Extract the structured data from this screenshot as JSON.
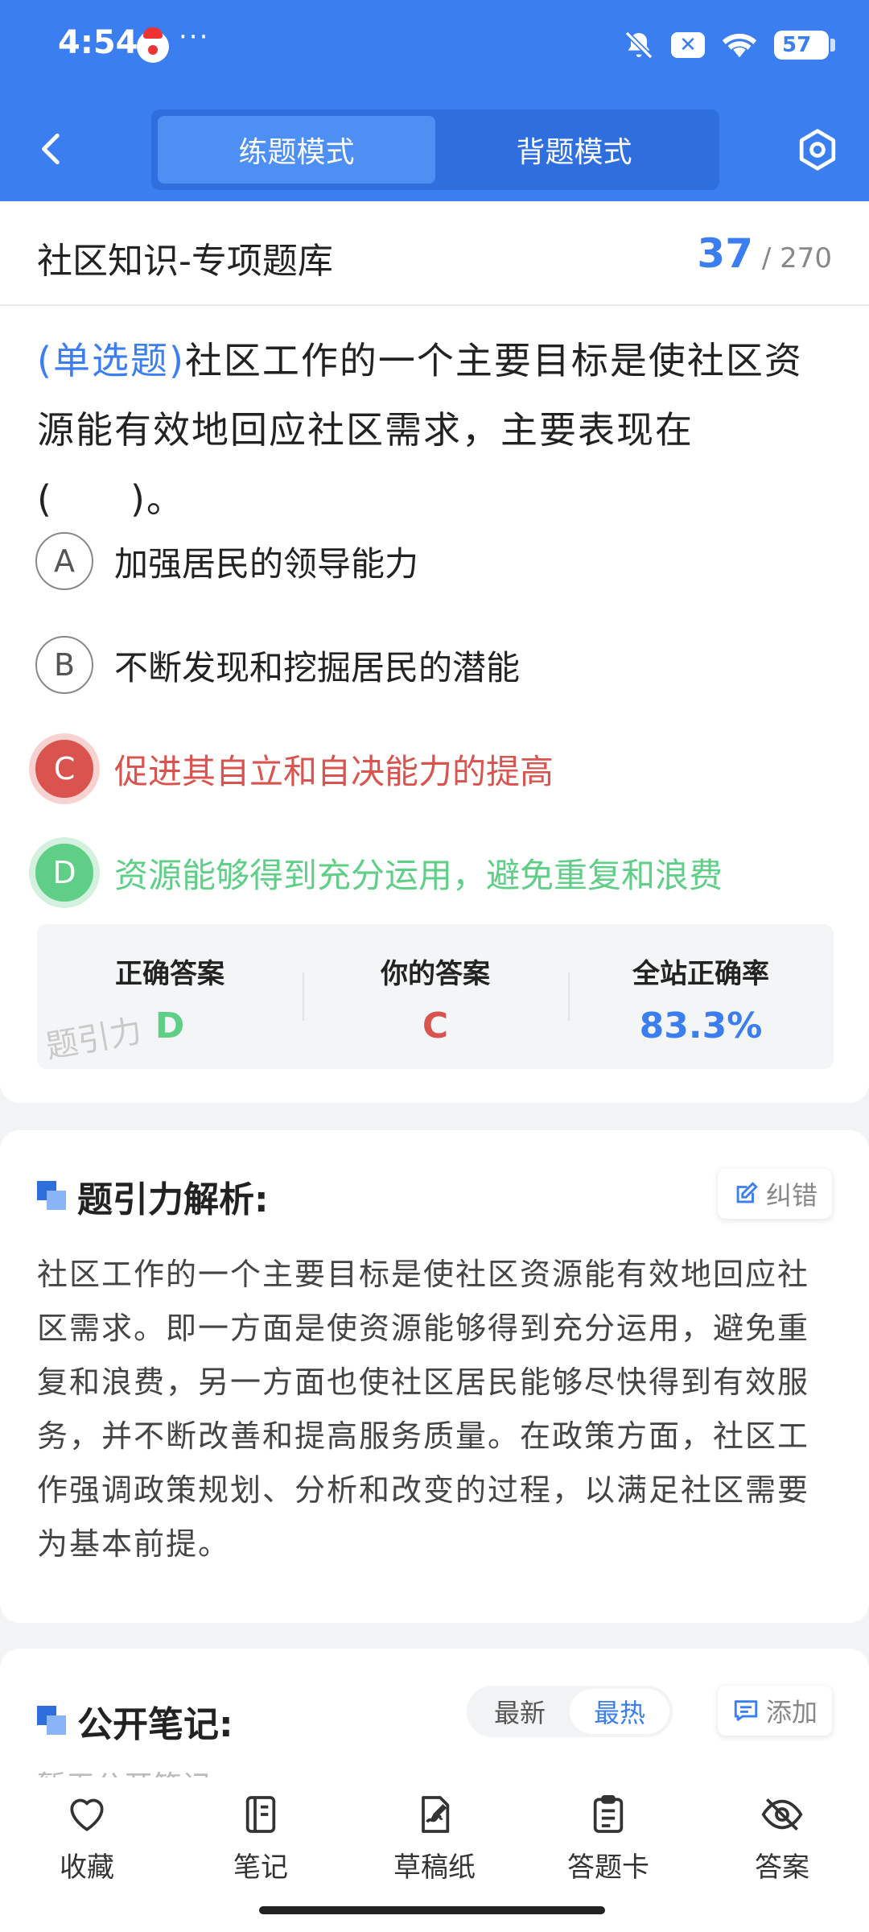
{
  "status_bar": {
    "time": "4:54",
    "dots": "···",
    "battery": "57"
  },
  "header": {
    "modes": [
      "练题模式",
      "背题模式"
    ],
    "active_mode": 0
  },
  "bank": {
    "title": "社区知识-专项题库",
    "current": "37",
    "total": "/ 270"
  },
  "question": {
    "type_label": "(单选题)",
    "text": "社区工作的一个主要目标是使社区资源能有效地回应社区需求，主要表现在(　　)。"
  },
  "options": [
    {
      "letter": "A",
      "text": "加强居民的领导能力",
      "state": "normal"
    },
    {
      "letter": "B",
      "text": "不断发现和挖掘居民的潜能",
      "state": "normal"
    },
    {
      "letter": "C",
      "text": "促进其自立和自决能力的提高",
      "state": "wrong"
    },
    {
      "letter": "D",
      "text": "资源能够得到充分运用，避免重复和浪费",
      "state": "right"
    }
  ],
  "result": {
    "correct_label": "正确答案",
    "correct_value": "D",
    "yours_label": "你的答案",
    "yours_value": "C",
    "rate_label": "全站正确率",
    "rate_value": "83.3%",
    "watermark": "题引力"
  },
  "analysis": {
    "title": "题引力解析:",
    "correct_button": "纠错",
    "text": "社区工作的一个主要目标是使社区资源能有效地回应社区需求。即一方面是使资源能够得到充分运用，避免重复和浪费，另一方面也使社区居民能够尽快得到有效服务，并不断改善和提高服务质量。在政策方面，社区工作强调政策规划、分析和改变的过程，以满足社区需要为基本前提。"
  },
  "notes": {
    "title": "公开笔记:",
    "sort": [
      "最新",
      "最热"
    ],
    "active_sort": 1,
    "add_button": "添加",
    "empty_text": "暂无公开笔记"
  },
  "bottom_tabs": [
    {
      "label": "收藏",
      "icon": "heart-icon"
    },
    {
      "label": "笔记",
      "icon": "notebook-icon"
    },
    {
      "label": "草稿纸",
      "icon": "draft-icon"
    },
    {
      "label": "答题卡",
      "icon": "clipboard-icon"
    },
    {
      "label": "答案",
      "icon": "eye-off-icon"
    }
  ],
  "colors": {
    "primary": "#3a7ef0",
    "wrong": "#d9534f",
    "right": "#5fcf87"
  }
}
